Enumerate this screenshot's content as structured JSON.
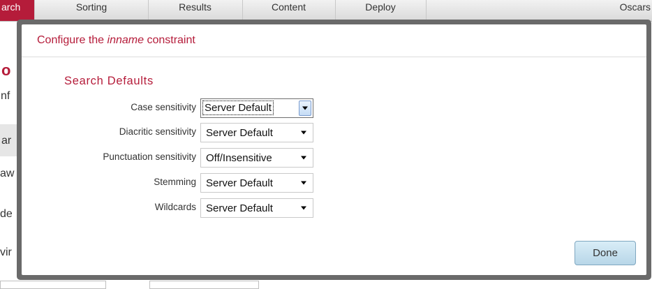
{
  "tabs": [
    {
      "label": "arch",
      "active": true
    },
    {
      "label": "Sorting",
      "active": false
    },
    {
      "label": "Results",
      "active": false
    },
    {
      "label": "Content",
      "active": false
    },
    {
      "label": "Deploy",
      "active": false
    }
  ],
  "tab_right_text": "Oscars",
  "background_fragments": {
    "heading": "o",
    "line_a": "nf",
    "line_b": "ar",
    "line_c": "aw",
    "line_d": "de",
    "line_e": "vir"
  },
  "dialog": {
    "title_prefix": "Configure the ",
    "title_constraint": "inname",
    "title_suffix": " constraint",
    "section_title": "Search Defaults",
    "settings": [
      {
        "label": "Case sensitivity",
        "value": "Server Default"
      },
      {
        "label": "Diacritic sensitivity",
        "value": "Server Default"
      },
      {
        "label": "Punctuation sensitivity",
        "value": "Off/Insensitive"
      },
      {
        "label": "Stemming",
        "value": "Server Default"
      },
      {
        "label": "Wildcards",
        "value": "Server Default"
      }
    ],
    "done_label": "Done"
  },
  "colors": {
    "accent": "#b51c3a",
    "frame": "#6a6a6a",
    "button": "#c9e2f0"
  },
  "icons": {
    "select_caret": "caret-down-icon"
  }
}
